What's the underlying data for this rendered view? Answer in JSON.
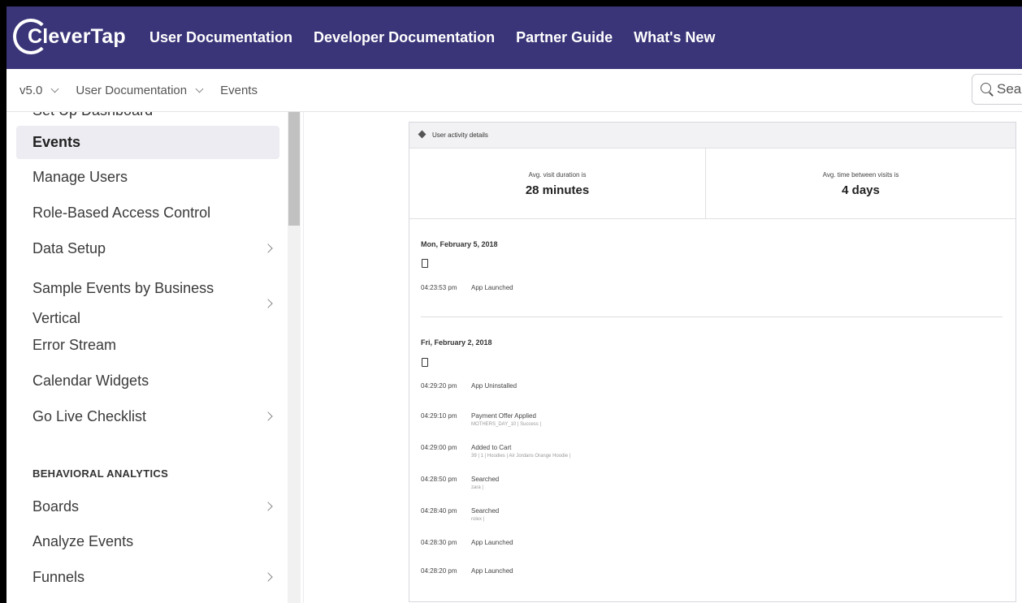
{
  "topnav": {
    "logo_text": "CleverTap",
    "links": [
      "User Documentation",
      "Developer Documentation",
      "Partner Guide",
      "What's New"
    ]
  },
  "breadcrumb": {
    "version": "v5.0",
    "section": "User Documentation",
    "page": "Events"
  },
  "search": {
    "placeholder": "Sea"
  },
  "sidebar": {
    "cut_item": "Set Up Dashboard",
    "items": [
      {
        "label": "Events",
        "active": true,
        "has_arrow": false
      },
      {
        "label": "Manage Users",
        "has_arrow": false
      },
      {
        "label": "Role-Based Access Control",
        "has_arrow": false
      },
      {
        "label": "Data Setup",
        "has_arrow": true
      },
      {
        "label": "Sample Events by Business Vertical",
        "has_arrow": true
      },
      {
        "label": "Error Stream",
        "has_arrow": false
      },
      {
        "label": "Calendar Widgets",
        "has_arrow": false
      },
      {
        "label": "Go Live Checklist",
        "has_arrow": true
      }
    ],
    "heading": "BEHAVIORAL ANALYTICS",
    "items2": [
      {
        "label": "Boards",
        "has_arrow": true
      },
      {
        "label": "Analyze Events",
        "has_arrow": false
      },
      {
        "label": "Funnels",
        "has_arrow": true
      }
    ]
  },
  "card": {
    "title": "User activity details",
    "stats": [
      {
        "label": "Avg. visit duration is",
        "value": "28 minutes"
      },
      {
        "label": "Avg. time between visits is",
        "value": "4 days"
      }
    ],
    "days": [
      {
        "date": "Mon, February 5, 2018",
        "events": [
          {
            "time": "04:23:53 pm",
            "name": "App Launched"
          }
        ]
      },
      {
        "date": "Fri, February 2, 2018",
        "events": [
          {
            "time": "04:29:20 pm",
            "name": "App Uninstalled"
          },
          {
            "time": "04:29:10 pm",
            "name": "Payment Offer Applied",
            "detail": "MOTHERS_DAY_10 | Success |"
          },
          {
            "time": "04:29:00 pm",
            "name": "Added to Cart",
            "detail": "39 | 1 | Hoodies | Air Jordans Orange Hoodie |"
          },
          {
            "time": "04:28:50 pm",
            "name": "Searched",
            "detail": "zara |"
          },
          {
            "time": "04:28:40 pm",
            "name": "Searched",
            "detail": "rolex |"
          },
          {
            "time": "04:28:30 pm",
            "name": "App Launched"
          },
          {
            "time": "04:28:20 pm",
            "name": "App Launched"
          }
        ]
      }
    ]
  },
  "colors": {
    "nav_bg": "#3a3578",
    "active_bg": "#ececf2"
  }
}
